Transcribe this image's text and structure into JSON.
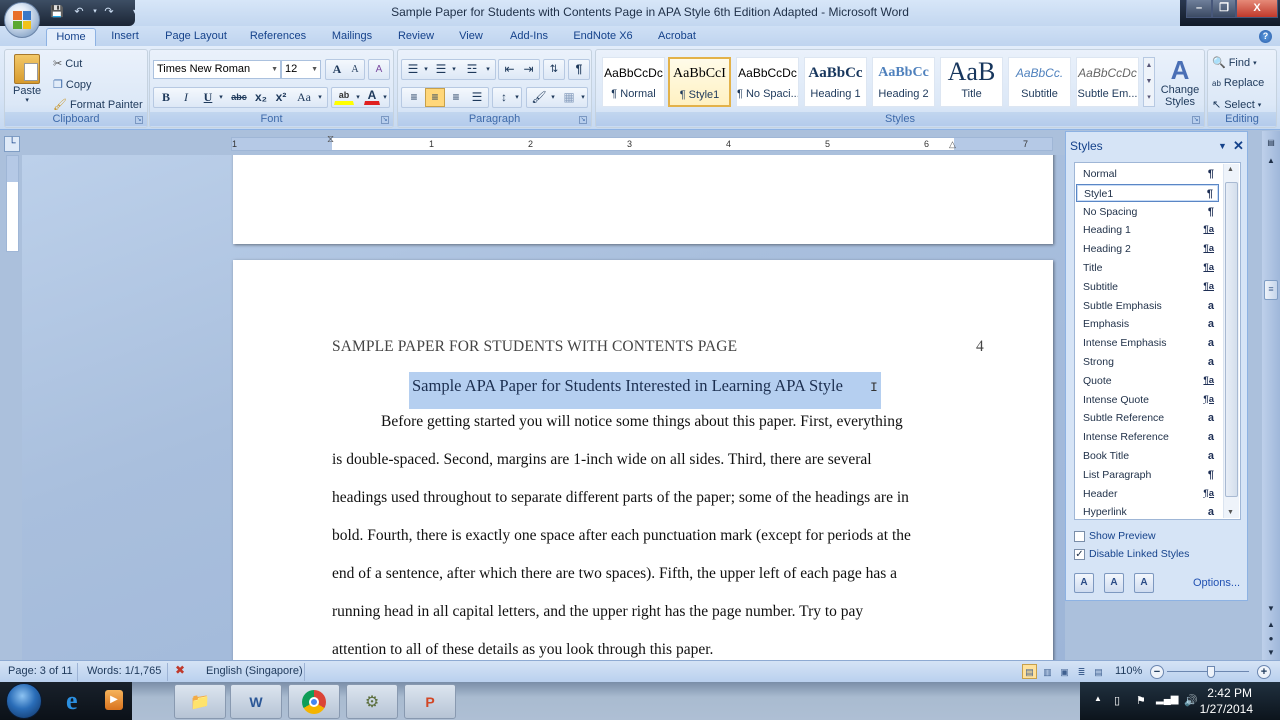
{
  "window": {
    "title": "Sample Paper for Students with Contents Page in APA Style 6th Edition Adapted - Microsoft Word",
    "controls": {
      "minimize": "–",
      "restore": "❐",
      "close": "X"
    }
  },
  "quick_access": {
    "icons": [
      "save-icon",
      "undo-icon",
      "redo-icon",
      "customize-icon"
    ]
  },
  "tabs": [
    {
      "label": "Home",
      "active": true
    },
    {
      "label": "Insert"
    },
    {
      "label": "Page Layout"
    },
    {
      "label": "References"
    },
    {
      "label": "Mailings"
    },
    {
      "label": "Review"
    },
    {
      "label": "View"
    },
    {
      "label": "Add-Ins"
    },
    {
      "label": "EndNote X6"
    },
    {
      "label": "Acrobat"
    }
  ],
  "ribbon": {
    "clipboard": {
      "label": "Clipboard",
      "paste": "Paste",
      "cut": "Cut",
      "copy": "Copy",
      "format_painter": "Format Painter"
    },
    "font": {
      "label": "Font",
      "font_name": "Times New Roman",
      "font_size": "12",
      "grow": "A",
      "shrink": "A",
      "clear": "A",
      "bold": "B",
      "italic": "I",
      "underline": "U",
      "strikethrough": "abc",
      "subscript": "x₂",
      "superscript": "x²",
      "change_case": "Aa",
      "highlight": "ab",
      "font_color": "A",
      "highlight_color": "#ffff00",
      "font_color_value": "#e02020"
    },
    "paragraph": {
      "label": "Paragraph",
      "active_alignment": "center"
    },
    "styles": {
      "label": "Styles",
      "gallery": [
        {
          "sample": "AaBbCcDc",
          "name": "¶ Normal"
        },
        {
          "sample": "AaBbCcI",
          "name": "¶ Style1",
          "selected": true
        },
        {
          "sample": "AaBbCcDc",
          "name": "¶ No Spaci..."
        },
        {
          "sample": "AaBbCc",
          "name": "Heading 1"
        },
        {
          "sample": "AaBbCc",
          "name": "Heading 2"
        },
        {
          "sample": "AaB",
          "name": "Title"
        },
        {
          "sample": "AaBbCc.",
          "name": "Subtitle"
        },
        {
          "sample": "AaBbCcDc",
          "name": "Subtle Em..."
        }
      ],
      "change_styles": "Change Styles"
    },
    "editing": {
      "label": "Editing",
      "find": "Find",
      "replace": "Replace",
      "select": "Select"
    }
  },
  "ruler": {
    "numbers": [
      "1",
      "1",
      "2",
      "3",
      "4",
      "5",
      "6",
      "7"
    ]
  },
  "document": {
    "running_head": "SAMPLE PAPER FOR STUDENTS WITH CONTENTS PAGE",
    "page_number": "4",
    "title": "Sample APA Paper for Students Interested in Learning APA Style",
    "body_lines": [
      "Before getting started you will notice some things about this paper.  First, everything",
      "is double-spaced.  Second, margins are 1-inch wide on all sides.  Third, there are several",
      "headings used throughout to separate different parts of the paper; some of the headings are in",
      "bold.  Fourth, there is exactly one space after each punctuation mark (except for periods at the",
      "end of a sentence, after which there are two spaces).  Fifth, the upper left of each page has a",
      "running head in all capital letters, and the upper right has the page number.  Try to pay",
      "attention to all of these details as you look through this paper."
    ]
  },
  "styles_pane": {
    "title": "Styles",
    "items": [
      {
        "name": "Normal",
        "type": "¶"
      },
      {
        "name": "Style1",
        "type": "¶",
        "selected": true
      },
      {
        "name": "No Spacing",
        "type": "¶"
      },
      {
        "name": "Heading 1",
        "type": "¶a",
        "linked": true
      },
      {
        "name": "Heading 2",
        "type": "¶a",
        "linked": true
      },
      {
        "name": "Title",
        "type": "¶a",
        "linked": true
      },
      {
        "name": "Subtitle",
        "type": "¶a",
        "linked": true
      },
      {
        "name": "Subtle Emphasis",
        "type": "a"
      },
      {
        "name": "Emphasis",
        "type": "a"
      },
      {
        "name": "Intense Emphasis",
        "type": "a"
      },
      {
        "name": "Strong",
        "type": "a"
      },
      {
        "name": "Quote",
        "type": "¶a",
        "linked": true
      },
      {
        "name": "Intense Quote",
        "type": "¶a",
        "linked": true
      },
      {
        "name": "Subtle Reference",
        "type": "a"
      },
      {
        "name": "Intense Reference",
        "type": "a"
      },
      {
        "name": "Book Title",
        "type": "a"
      },
      {
        "name": "List Paragraph",
        "type": "¶"
      },
      {
        "name": "Header",
        "type": "¶a",
        "linked": true
      },
      {
        "name": "Hyperlink",
        "type": "a"
      }
    ],
    "show_preview": {
      "label": "Show Preview",
      "checked": false
    },
    "disable_linked": {
      "label": "Disable Linked Styles",
      "checked": true
    },
    "options": "Options..."
  },
  "statusbar": {
    "page": "Page: 3 of 11",
    "words": "Words: 1/1,765",
    "language": "English (Singapore)",
    "zoom": "110%",
    "zoom_percent": 110
  },
  "taskbar": {
    "apps": [
      "windows-explorer",
      "microsoft-word",
      "google-chrome",
      "network-tool",
      "microsoft-powerpoint"
    ],
    "time": "2:42 PM",
    "date": "1/27/2014"
  }
}
